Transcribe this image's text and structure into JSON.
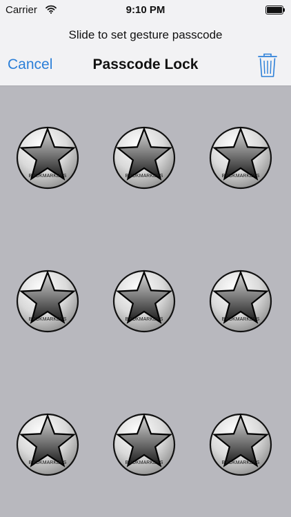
{
  "status_bar": {
    "carrier": "Carrier",
    "time": "9:10 PM",
    "wifi_icon": "wifi-icon",
    "battery_icon": "battery-icon",
    "battery_level": 1.0
  },
  "header": {
    "prompt": "Slide to set gesture passcode",
    "cancel_label": "Cancel",
    "title": "Passcode Lock",
    "trash_icon": "trash-icon"
  },
  "colors": {
    "accent": "#2b7fd8",
    "header_bg": "#f2f2f4",
    "grid_bg": "#b8b8be"
  },
  "grid": {
    "rows": 3,
    "cols": 3,
    "nodes": [
      {
        "label": "BOOKMARKERS",
        "icon": "star-icon"
      },
      {
        "label": "BOOKMARKERS",
        "icon": "star-icon"
      },
      {
        "label": "BOOKMARKERS",
        "icon": "star-icon"
      },
      {
        "label": "BOOKMARKERS",
        "icon": "star-icon"
      },
      {
        "label": "BOOKMARKERS",
        "icon": "star-icon"
      },
      {
        "label": "BOOKMARKERS",
        "icon": "star-icon"
      },
      {
        "label": "BOOKMARKERS",
        "icon": "star-icon"
      },
      {
        "label": "BOOKMARKERS",
        "icon": "star-icon"
      },
      {
        "label": "BOOKMARKERS",
        "icon": "star-icon"
      }
    ]
  }
}
